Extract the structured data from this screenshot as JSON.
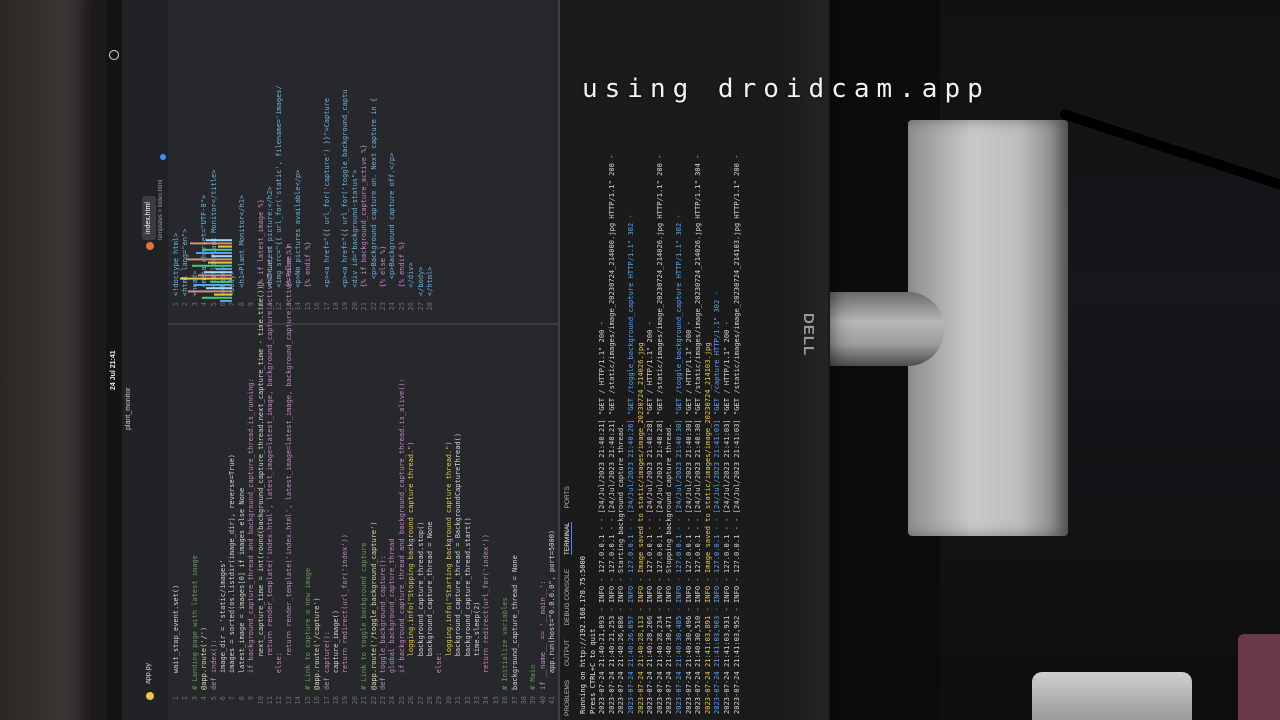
{
  "watermark": "using droidcam.app",
  "monitor_brand": "DELL",
  "gnome": {
    "clock": "24 Jul 21:41",
    "folder": "plant_monitor"
  },
  "tabs": {
    "active": "index.html",
    "breadcrumb": "templates > index.html"
  },
  "html_code": [
    "<!doctype html>",
    "<html lang=\"en\">",
    "<head>",
    "  <meta charset=\"UTF-8\">",
    "  <title>Plant Monitor</title>",
    "</head>",
    "<body>",
    "  <h1>Plant Monitor</h1>",
    "",
    "  {% if latest_image %}",
    "  <h2>Latest picture:</h2>",
    "  <img src=\"{{ url_for('static', filename='images/",
    "  {% else %}",
    "  <p>No pictures available</p>",
    "  {% endif %}",
    "",
    "  <p><a href=\"{{ url_for('capture') }}\">Capture",
    "",
    "  <p><a href=\"{{ url_for('toggle_background_captu",
    "  <div id=\"background-status\">",
    "  {% if background_capture_active %}",
    "    <p>Background capture on. Next capture in {",
    "  {% else %}",
    "    <p>Background capture off.</p>",
    "  {% endif %}",
    "  </div>",
    "</body>",
    "</html>"
  ],
  "python_code": [
    "    wait_stop_event.set()",
    "",
    "# Landing page with latest image",
    "@app.route('/')",
    "def index():",
    "    image_dir = 'static/images'",
    "    images = sorted(os.listdir(image_dir), reverse=True)",
    "    latest_image = images[0] if images else None",
    "    if background_capture_thread and background_capture_thread.is_running:",
    "        next_capture_time = int(round(background_capture_thread.next_capture_time - time.time()))",
    "        return render_template('index.html', latest_image=latest_image, background_capture_active=True, n",
    "    else:",
    "        return render_template('index.html', latest_image=latest_image, background_capture_active=False, n",
    "",
    "# Link to capture a new image",
    "@app.route('/capture')",
    "def capture():",
    "    capture_image()",
    "    return redirect(url_for('index'))",
    "",
    "# Link to toggle background capture",
    "@app.route('/toggle_background_capture')",
    "def toggle_background_capture():",
    "    global background_capture_thread",
    "    if background_capture_thread and background_capture_thread.is_alive():",
    "        logging.info(\"Stopping background capture thread.\")",
    "        background_capture_thread.stop()",
    "        background_capture_thread = None",
    "    else:",
    "        logging.info(\"Starting background capture thread.\")",
    "        background_capture_thread = BackgroundCaptureThread()",
    "        background_capture_thread.start()",
    "        time.sleep(2)",
    "    return redirect(url_for('index'))",
    "",
    "# Initialize variables",
    "background_capture_thread = None",
    "",
    "# Main",
    "if __name__ == '__main__':",
    "    app.run(host=\"0.0.0.0\", port=5000)"
  ],
  "panel_tabs": [
    "PROBLEMS",
    "OUTPUT",
    "DEBUG CONSOLE",
    "TERMINAL",
    "PORTS"
  ],
  "terminal": [
    "Running on http://192.168.178.75:5000",
    "Press CTRL+C to quit",
    "2023-07-24 21:40:21,093 - INFO - 127.0.0.1 - - [24/Jul/2023 21:40:21] \"GET / HTTP/1.1\" 200 -",
    "2023-07-24 21:40:21,253 - INFO - 127.0.0.1 - - [24/Jul/2023 21:40:21] \"GET /static/images/image_20230724_214000.jpg HTTP/1.1\" 200 -",
    "2023-07-24 21:40:26,086 - INFO - Starting background capture thread.",
    "2023-07-24 21:40:26,097 - INFO - 127.0.0.1 - - [24/Jul/2023 21:40:26] \"GET /toggle_background_capture HTTP/1.1\" 302 -",
    "2023-07-24 21:40:28,113 - INFO - Image saved to static/images/image_20230724_214026.jpg",
    "2023-07-24 21:40:28,206 - INFO - 127.0.0.1 - - [24/Jul/2023 21:40:28] \"GET / HTTP/1.1\" 200 -",
    "2023-07-24 21:40:28,234 - INFO - 127.0.0.1 - - [24/Jul/2023 21:40:28] \"GET /static/images/image_20230724_214026.jpg HTTP/1.1\" 200 -",
    "2023-07-24 21:40:30,471 - INFO - Stopping background capture thread.",
    "2023-07-24 21:40:30,485 - INFO - 127.0.0.1 - - [24/Jul/2023 21:40:30] \"GET /toggle_background_capture HTTP/1.1\" 302 -",
    "2023-07-24 21:40:30,496 - INFO - 127.0.0.1 - - [24/Jul/2023 21:40:30] \"GET / HTTP/1.1\" 200 -",
    "2023-07-24 21:40:30,510 - INFO - 127.0.0.1 - - [24/Jul/2023 21:40:30] \"GET /static/images/image_20230724_214026.jpg HTTP/1.1\" 304 -",
    "2023-07-24 21:41:03,891 - INFO - Image saved to static/images/image_20230724_214103.jpg",
    "2023-07-24 21:41:03,903 - INFO - 127.0.0.1 - - [24/Jul/2023 21:41:03] \"GET /capture HTTP/1.1\" 302 -",
    "2023-07-24 21:41:03,931 - INFO - 127.0.0.1 - - [24/Jul/2023 21:41:03] \"GET / HTTP/1.1\" 200 -",
    "2023-07-24 21:41:03,952 - INFO - 127.0.0.1 - - [24/Jul/2023 21:41:03] \"GET /static/images/image_20230724_214103.jpg HTTP/1.1\" 200 -"
  ]
}
